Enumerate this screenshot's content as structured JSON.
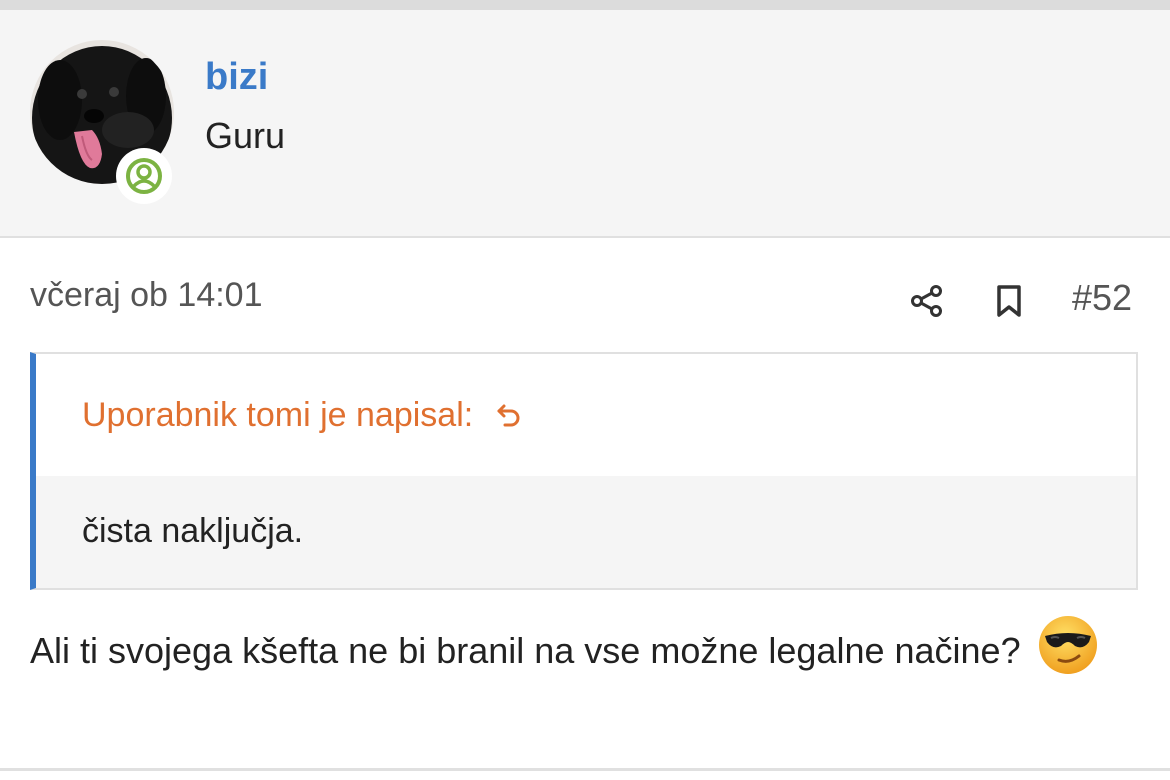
{
  "user": {
    "name": "bizi",
    "title": "Guru",
    "avatar_icon": "black-dog-avatar",
    "status_icon": "online-user-icon",
    "status_color": "#7cb342"
  },
  "post": {
    "timestamp": "včeraj ob 14:01",
    "number": "#52",
    "share_icon": "share-icon",
    "bookmark_icon": "bookmark-icon"
  },
  "quote": {
    "attribution": "Uporabnik tomi je napisal:",
    "jump_icon": "jump-to-quote-icon",
    "text": "čista naključja."
  },
  "message": {
    "text": "Ali ti svojega kšefta ne bi branil na vse možne legalne načine?",
    "emoji": "cool-sunglasses-emoji"
  },
  "colors": {
    "link_blue": "#3a7ac8",
    "quote_orange": "#e07030",
    "header_bg": "#f5f5f5"
  }
}
